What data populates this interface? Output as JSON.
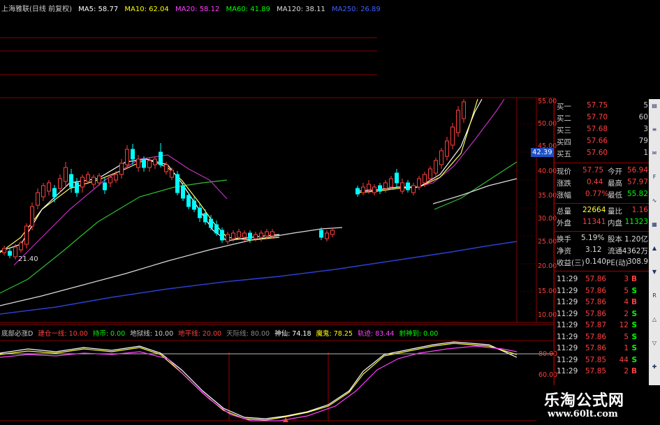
{
  "main_legend": {
    "title": "上海雅联(日线 前复权)",
    "ma": [
      {
        "label": "MA5: 58.77",
        "color": "#ffffff"
      },
      {
        "label": "MA10: 62.04",
        "color": "#ffff00"
      },
      {
        "label": "MA20: 58.12",
        "color": "#ff40ff"
      },
      {
        "label": "MA60: 41.89",
        "color": "#00ff00"
      },
      {
        "label": "MA120: 38.11",
        "color": "#dddddd"
      },
      {
        "label": "MA250: 26.89",
        "color": "#4060ff"
      }
    ]
  },
  "price_axis": {
    "ticks": [
      "55.00",
      "50.00",
      "45.00",
      "40.00",
      "35.00",
      "30.00",
      "25.00",
      "20.00",
      "15.00",
      "10.00"
    ],
    "current_tag": "42.39",
    "low_label": "21.40"
  },
  "indicator_legend": {
    "name": "底部必涨D",
    "items": [
      {
        "label": "建仓一线: 10.00",
        "color": "#ff4040"
      },
      {
        "label": "持币: 0.00",
        "color": "#00ff00"
      },
      {
        "label": "地狱线: 10.00",
        "color": "#cccccc"
      },
      {
        "label": "地平线: 20.00",
        "color": "#ff4040"
      },
      {
        "label": "天际线: 80.00",
        "color": "#888888"
      },
      {
        "label": "神仙: 74.18",
        "color": "#ffffff"
      },
      {
        "label": "魔鬼: 78.25",
        "color": "#ffff00"
      },
      {
        "label": "轨迹: 83.44",
        "color": "#ff40ff"
      },
      {
        "label": "射神到: 0.00",
        "color": "#00ff00"
      }
    ],
    "axis": [
      "80.00",
      "60.00"
    ]
  },
  "order_book": [
    {
      "label": "买一",
      "price": "57.75",
      "qty": "5"
    },
    {
      "label": "买二",
      "price": "57.70",
      "qty": "60"
    },
    {
      "label": "买三",
      "price": "57.68",
      "qty": "3"
    },
    {
      "label": "买四",
      "price": "57.66",
      "qty": "79"
    },
    {
      "label": "买五",
      "price": "57.60",
      "qty": "1"
    }
  ],
  "quote_rows": [
    {
      "l1": "现价",
      "v1": "57.75",
      "l2": "今开",
      "v2": "56.94"
    },
    {
      "l1": "涨跌",
      "v1": "0.44",
      "l2": "最高",
      "v2": "57.97"
    },
    {
      "l1": "涨幅",
      "v1": "0.77%",
      "l2": "最低",
      "v2": "55.82"
    },
    {
      "l1": "总量",
      "v1": "22664",
      "l2": "量比",
      "v2": "1.16"
    },
    {
      "l1": "外盘",
      "v1": "11341",
      "l2": "内盘",
      "v2": "11323"
    },
    {
      "l1": "换手",
      "v1": "5.19%",
      "l2": "股本",
      "v2": "1.20亿"
    },
    {
      "l1": "净资",
      "v1": "3.12",
      "l2": "流通",
      "v2": "4362万"
    },
    {
      "l1": "收益(三)",
      "v1": "0.140",
      "l2": "PE(动)",
      "v2": "308.9"
    }
  ],
  "trades": [
    {
      "time": "11:29",
      "price": "57.86",
      "qty": "3",
      "side": "B"
    },
    {
      "time": "11:29",
      "price": "57.86",
      "qty": "5",
      "side": "S"
    },
    {
      "time": "11:29",
      "price": "57.86",
      "qty": "4",
      "side": "B"
    },
    {
      "time": "11:29",
      "price": "57.86",
      "qty": "2",
      "side": "S"
    },
    {
      "time": "11:29",
      "price": "57.87",
      "qty": "12",
      "side": "S"
    },
    {
      "time": "11:29",
      "price": "57.86",
      "qty": "5",
      "side": "S"
    },
    {
      "time": "11:29",
      "price": "57.86",
      "qty": "1",
      "side": "S"
    },
    {
      "time": "11:29",
      "price": "57.85",
      "qty": "44",
      "side": "S"
    },
    {
      "time": "11:29",
      "price": "57.85",
      "qty": "2",
      "side": "B"
    }
  ],
  "sidebar_icons": [
    "chart-icon",
    "list-icon",
    "news-icon",
    "f10-icon",
    "line-icon",
    "grid-icon",
    "up-icon",
    "down-icon",
    "rsi-icon",
    "up2-icon",
    "down2-icon",
    "mark-icon"
  ],
  "watermark": {
    "line1": "乐淘公式网",
    "line2": "www.60lt.com"
  },
  "colors": {
    "up": "#ff4040",
    "down": "#00ffff",
    "grid": "#a00000",
    "buy_side": "#ff4040",
    "sell_side": "#00ff00"
  }
}
